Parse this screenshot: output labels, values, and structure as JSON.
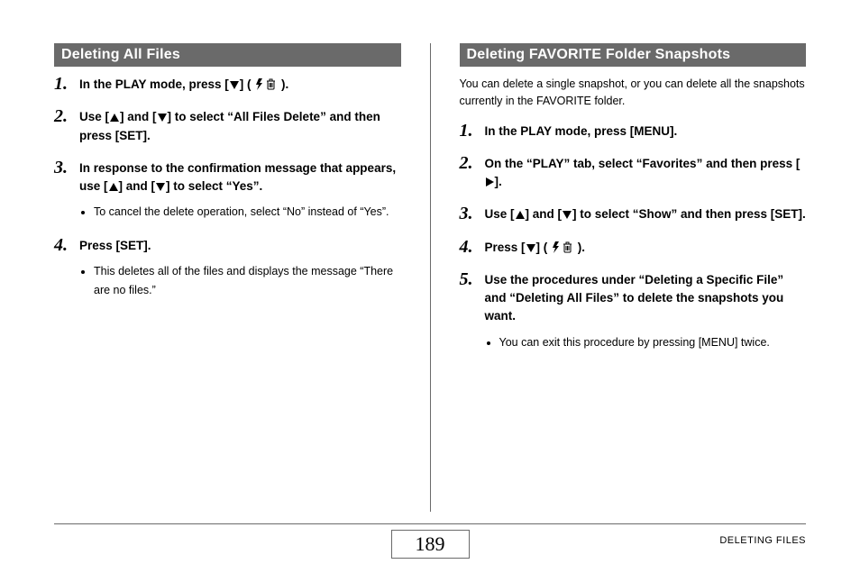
{
  "left": {
    "title": "Deleting All Files",
    "steps": [
      {
        "main_parts": [
          "In the PLAY mode, press [",
          "DOWN",
          "] ( ",
          "ICONS",
          " )."
        ]
      },
      {
        "main_parts": [
          "Use [",
          "UP",
          "] and [",
          "DOWN",
          "] to select “All Files Delete” and then press [SET]."
        ]
      },
      {
        "main_parts": [
          "In response to the confirmation message that appears, use [",
          "UP",
          "] and [",
          "DOWN",
          "] to select “Yes”."
        ],
        "subs": [
          "To cancel the delete operation, select “No” instead of “Yes”."
        ]
      },
      {
        "main_parts": [
          "Press [SET]."
        ],
        "subs": [
          "This deletes all of the files and displays the message “There are no files.”"
        ]
      }
    ]
  },
  "right": {
    "title": "Deleting FAVORITE Folder Snapshots",
    "intro": "You can delete a single snapshot, or you can delete all the snapshots currently in the FAVORITE folder.",
    "steps": [
      {
        "main_parts": [
          "In the PLAY mode, press [MENU]."
        ]
      },
      {
        "main_parts": [
          "On the “PLAY” tab, select “Favorites” and then press [",
          "RIGHT",
          "]."
        ]
      },
      {
        "main_parts": [
          "Use [",
          "UP",
          "] and [",
          "DOWN",
          "] to select “Show” and then press [SET]."
        ]
      },
      {
        "main_parts": [
          "Press [",
          "DOWN",
          "] ( ",
          "ICONS",
          " )."
        ]
      },
      {
        "main_parts": [
          "Use the procedures under “Deleting a Specific File” and “Deleting All Files” to delete the snapshots you want."
        ],
        "subs": [
          "You can exit this procedure by pressing [MENU] twice."
        ]
      }
    ]
  },
  "footer": {
    "page": "189",
    "section": "DELETING FILES"
  }
}
